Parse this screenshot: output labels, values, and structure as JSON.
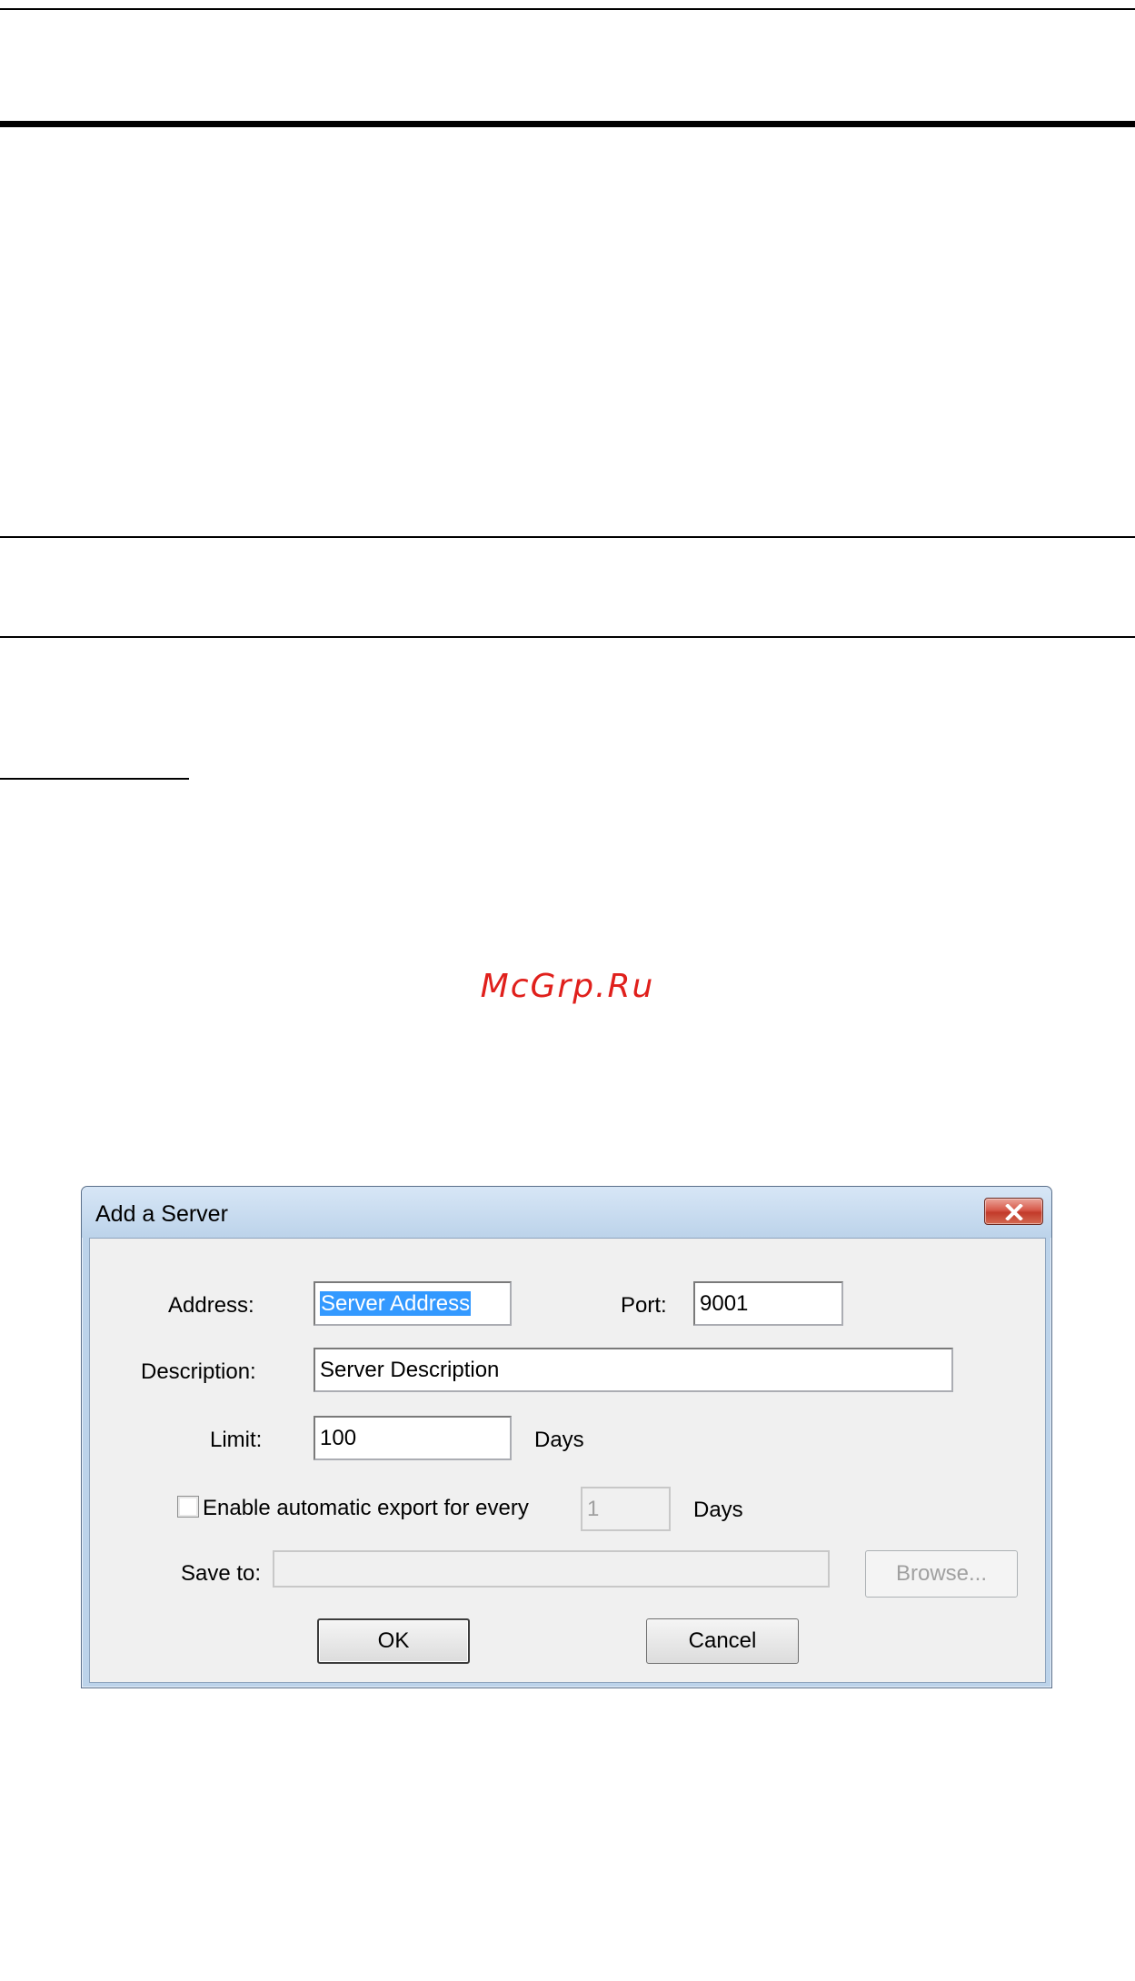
{
  "watermark": "McGrp.Ru",
  "dialog": {
    "title": "Add a Server",
    "close_icon": "close-x-icon",
    "address_label": "Address:",
    "address_value": "Server Address",
    "port_label": "Port:",
    "port_value": "9001",
    "description_label": "Description:",
    "description_value": "Server Description",
    "limit_label": "Limit:",
    "limit_value": "100",
    "limit_unit": "Days",
    "auto_export_checked": false,
    "auto_export_label": "Enable automatic export for every",
    "auto_export_value": "1",
    "auto_export_unit": "Days",
    "save_to_label": "Save to:",
    "save_to_value": "",
    "browse_label": "Browse...",
    "ok_label": "OK",
    "cancel_label": "Cancel"
  }
}
